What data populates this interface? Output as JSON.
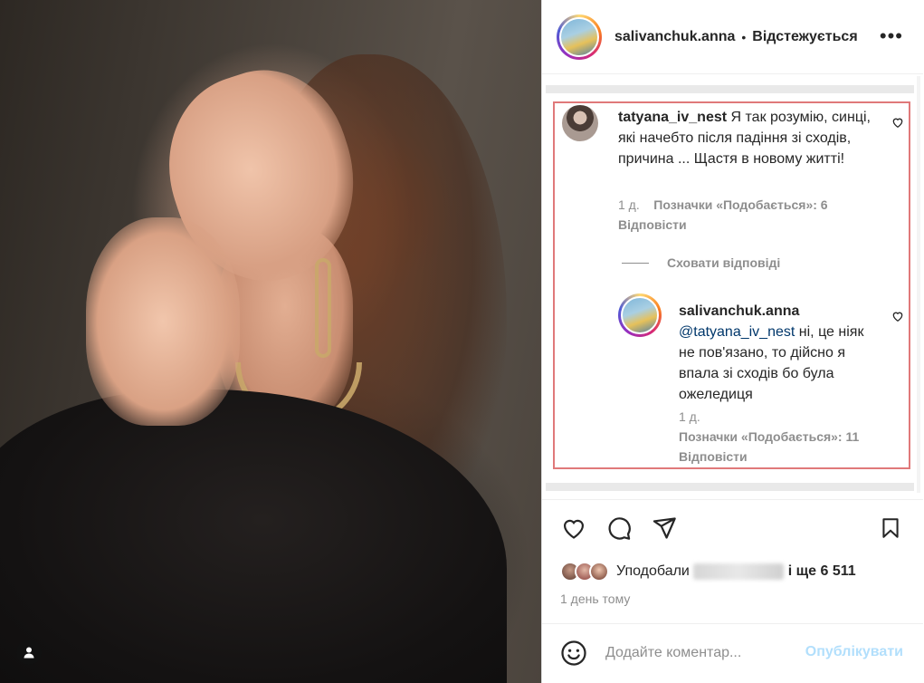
{
  "photo": {
    "user_tag_icon": "person-icon"
  },
  "header": {
    "username": "salivanchuk.anna",
    "separator": "•",
    "follow_status": "Відстежується",
    "more_icon": "•••"
  },
  "comment": {
    "username": "tatyana_iv_nest",
    "text": "Я так розумію, синці, які начебто після падіння зі сходів, причина ... Щастя в новому житті!",
    "time": "1 д.",
    "likes": "Позначки «Подобається»: 6",
    "reply_label": "Відповісти",
    "hide_replies": "Сховати відповіді"
  },
  "reply": {
    "username": "salivanchuk.anna",
    "mention": "@tatyana_iv_nest",
    "text": "ні, це ніяк не пов'язано, то дійсно я впала зі сходів бо була ожеледиця",
    "time": "1 д.",
    "likes": "Позначки «Подобається»: 11",
    "reply_label": "Відповісти"
  },
  "likes_row": {
    "prefix": "Уподобали",
    "suffix": "і ще 6 511"
  },
  "time_ago": "1 день тому",
  "add_comment": {
    "placeholder": "Додайте коментар...",
    "post_label": "Опублікувати"
  },
  "colors": {
    "highlight_border": "#e0797a",
    "post_button": "#b2dffc",
    "mention": "#00376b"
  }
}
